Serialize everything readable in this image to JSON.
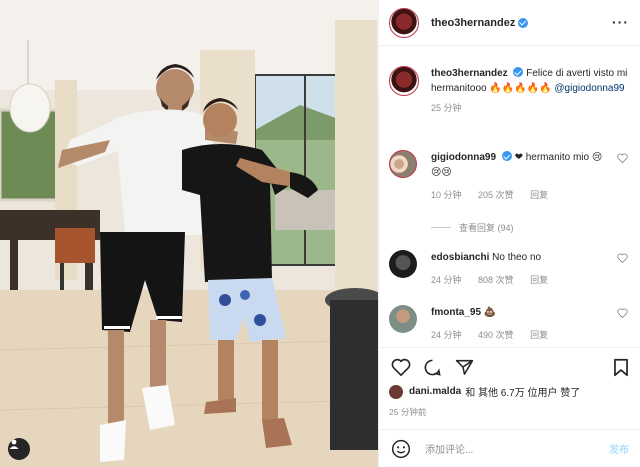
{
  "post": {
    "author": "theo3hernandez",
    "caption_text": "Felice di averti visto mi hermanitooo 🔥🔥🔥🔥🔥",
    "caption_mention": "@gigiodonna99",
    "caption_time": "25 分钟"
  },
  "comments": [
    {
      "user": "gigiodonna99",
      "text": "❤ hermanito mio 😢😢😢",
      "time": "10 分钟",
      "likes": "205 次赞",
      "reply": "回复"
    },
    {
      "user": "edosbianchi",
      "text": "No theo no",
      "time": "24 分钟",
      "likes": "808 次赞",
      "reply": "回复"
    },
    {
      "user": "fmonta_95",
      "text": "💩",
      "time": "24 分钟",
      "likes": "490 次赞",
      "reply": "回复"
    }
  ],
  "view_replies": "查看回复 (94)",
  "likes": {
    "user": "dani.malda",
    "rest": "和 其他 6.7万 位用户 赞了"
  },
  "post_time": "25 分钟前",
  "add_comment": {
    "placeholder": "添加评论...",
    "post_label": "发布"
  },
  "icons": {
    "more": "more-options-icon",
    "heart": "heart-icon",
    "comment": "comment-icon",
    "share": "share-icon",
    "save": "bookmark-icon",
    "emoji": "emoji-icon",
    "tag": "user-tag-icon"
  },
  "colors": {
    "verified": "#3897f0",
    "link": "#00376b",
    "muted": "#8e8e8e"
  }
}
